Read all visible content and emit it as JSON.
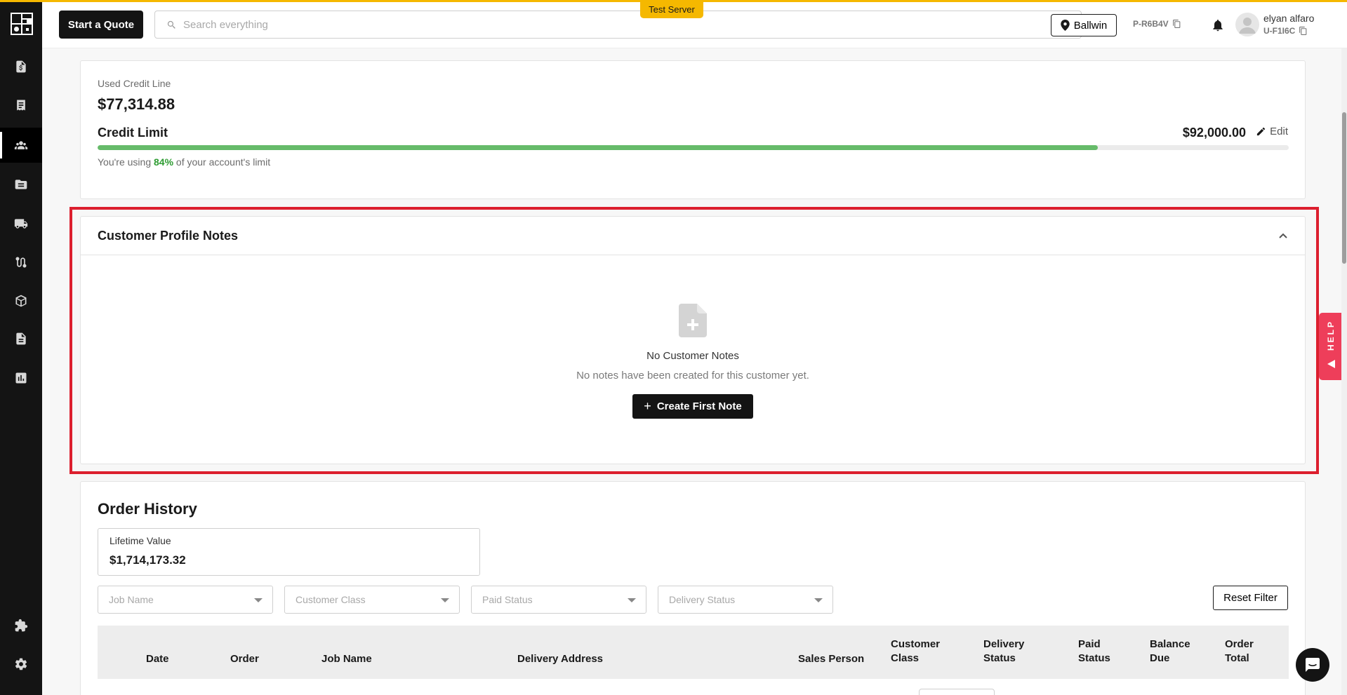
{
  "header": {
    "start_quote": "Start a Quote",
    "search_placeholder": "Search everything",
    "test_badge": "Test Server",
    "location": "Ballwin",
    "p_code": "P-R6B4V",
    "user_name": "elyan alfaro",
    "u_code": "U-F1I6C"
  },
  "sidebar": {
    "items": [
      {
        "icon": "invoice-dollar-icon"
      },
      {
        "icon": "receipt-icon"
      },
      {
        "icon": "users-icon",
        "active": true
      },
      {
        "icon": "folder-icon"
      },
      {
        "icon": "truck-icon"
      },
      {
        "icon": "route-icon"
      },
      {
        "icon": "box-icon"
      },
      {
        "icon": "document-icon"
      },
      {
        "icon": "chart-icon"
      }
    ],
    "bottom_items": [
      {
        "icon": "puzzle-icon"
      },
      {
        "icon": "gear-icon"
      }
    ]
  },
  "credit": {
    "used_label": "Used Credit Line",
    "used_value": "$77,314.88",
    "limit_label": "Credit Limit",
    "limit_value": "$92,000.00",
    "edit_label": "Edit",
    "usage_prefix": "You're using",
    "usage_percent": "84%",
    "usage_suffix": "of your account's limit",
    "usage_fraction": 0.84
  },
  "notes": {
    "title": "Customer Profile Notes",
    "empty_title": "No Customer Notes",
    "empty_subtitle": "No notes have been created for this customer yet.",
    "create_button": "Create First Note"
  },
  "orders": {
    "title": "Order History",
    "lifetime_label": "Lifetime Value",
    "lifetime_value": "$1,714,173.32",
    "filters": [
      "Job Name",
      "Customer Class",
      "Paid Status",
      "Delivery Status"
    ],
    "reset_filter": "Reset Filter",
    "columns": [
      {
        "line1": "Date",
        "line2": ""
      },
      {
        "line1": "Order",
        "line2": ""
      },
      {
        "line1": "Job Name",
        "line2": ""
      },
      {
        "line1": "Delivery Address",
        "line2": ""
      },
      {
        "line1": "Sales Person",
        "line2": ""
      },
      {
        "line1": "Customer",
        "line2": "Class"
      },
      {
        "line1": "Delivery",
        "line2": "Status"
      },
      {
        "line1": "Paid",
        "line2": "Status"
      },
      {
        "line1": "Balance",
        "line2": "Due"
      },
      {
        "line1": "Order",
        "line2": "Total"
      }
    ]
  },
  "help": {
    "label": "HELP"
  },
  "colors": {
    "accent": "#f5b800",
    "highlight": "#dc1f2e",
    "progress": "#66bb6a",
    "help": "#ee3e5a"
  }
}
